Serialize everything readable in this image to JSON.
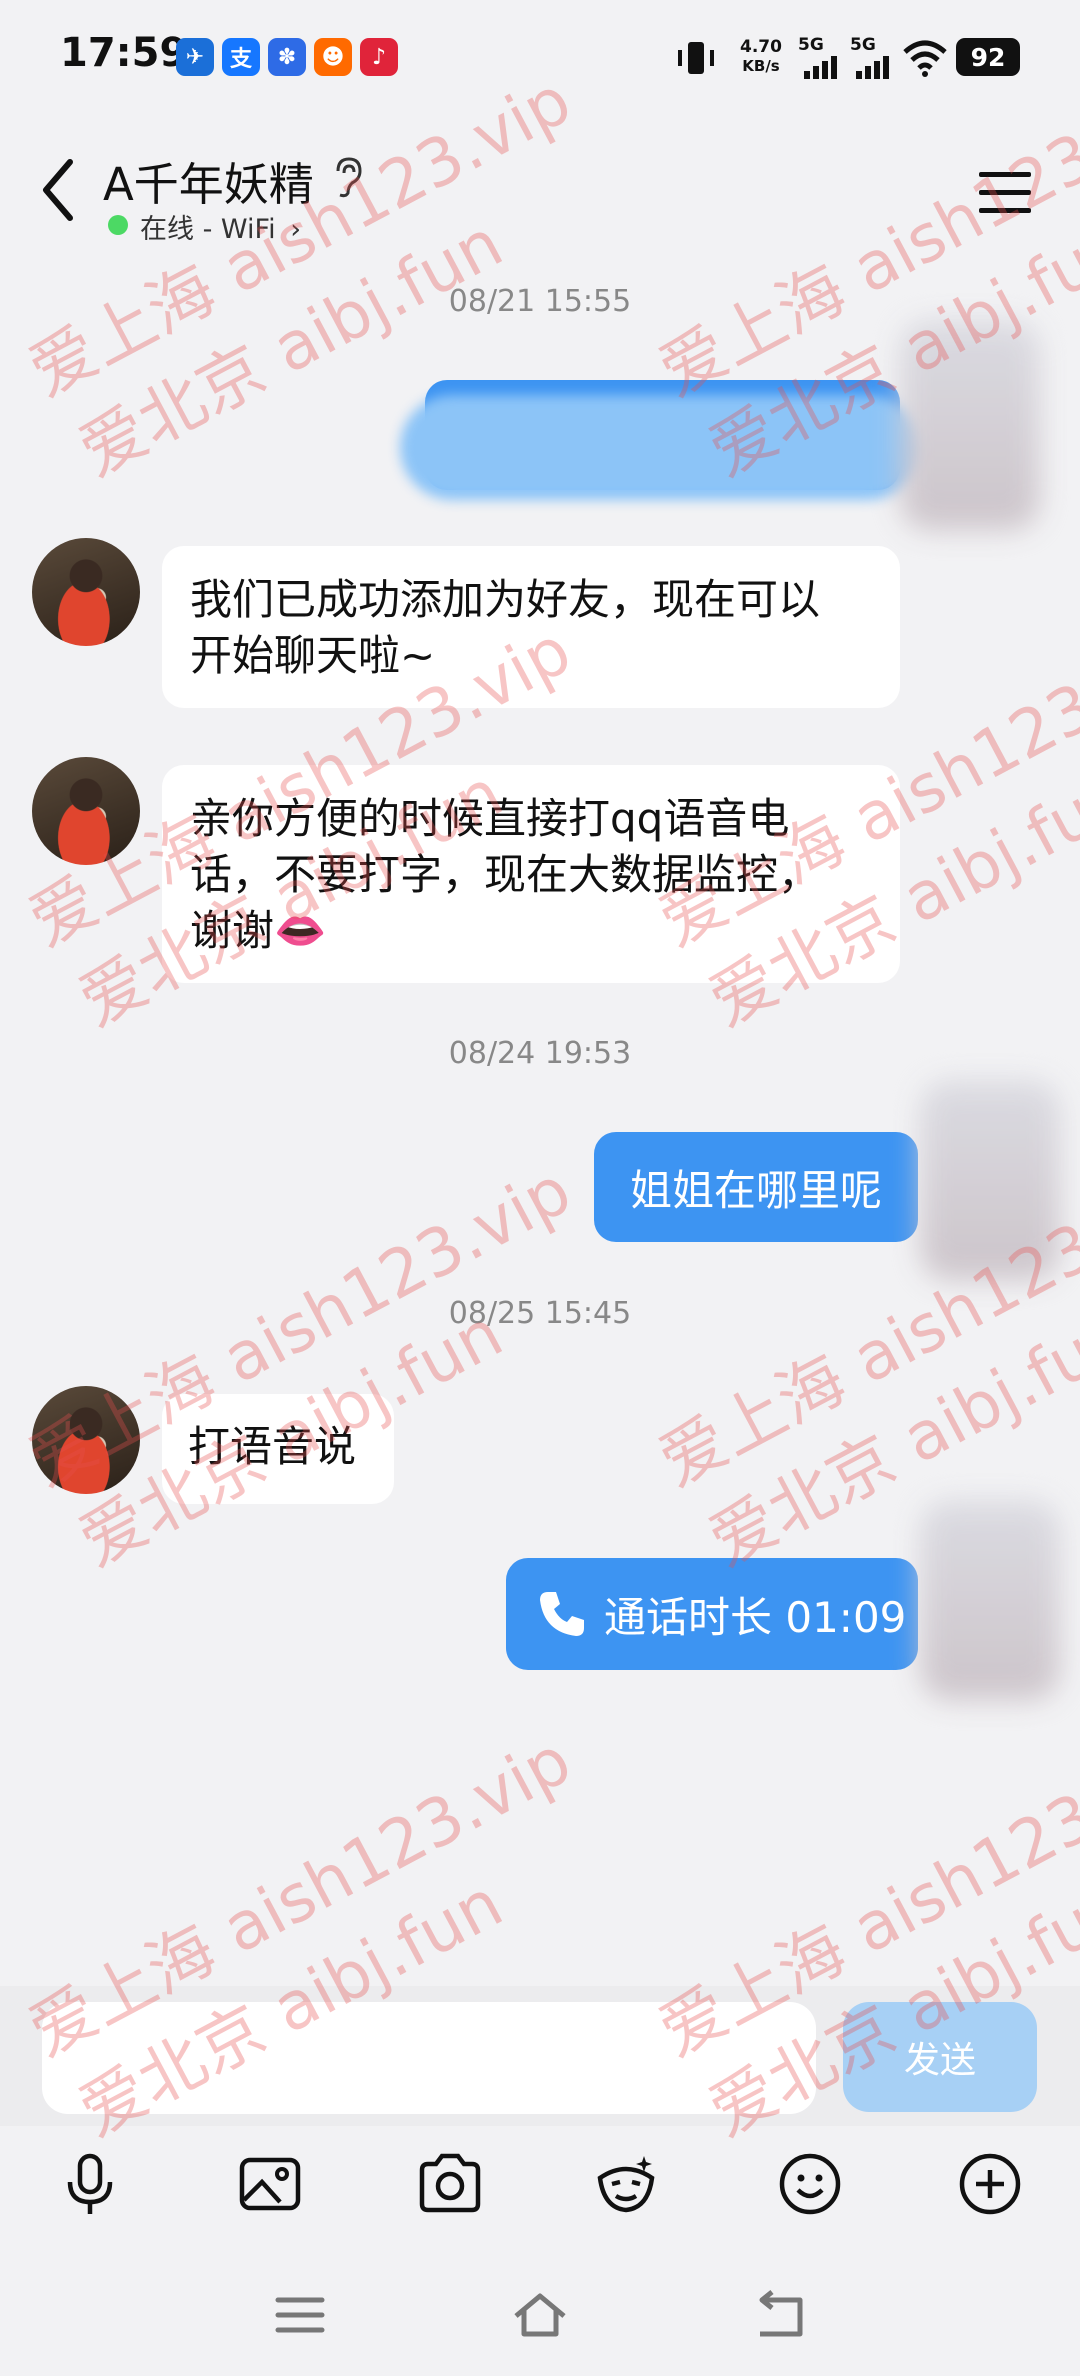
{
  "status_bar": {
    "time": "17:59",
    "net_speed": "4.70",
    "net_speed_unit": "KB/s",
    "sim1": "5G",
    "sim2": "5G",
    "battery": "92",
    "app_icons": [
      "feishu-icon",
      "alipay-icon",
      "baidu-icon",
      "taobao-icon",
      "xiaohongshu-icon"
    ]
  },
  "header": {
    "title": "A千年妖精",
    "status": "在线 - WiFi",
    "status_color": "#4cd964"
  },
  "messages": [
    {
      "type": "timestamp",
      "text": "08/21 15:55"
    },
    {
      "type": "left",
      "lines": [
        "我们已成功添加为好友，现在可以",
        "开始聊天啦~"
      ]
    },
    {
      "type": "left",
      "lines": [
        "亲你方便的时候直接打qq语音电",
        "话，不要打字，现在大数据监控，",
        "谢谢👄"
      ]
    },
    {
      "type": "timestamp",
      "text": "08/24 19:53"
    },
    {
      "type": "right",
      "text": "姐姐在哪里呢"
    },
    {
      "type": "timestamp",
      "text": "08/25 15:45"
    },
    {
      "type": "left",
      "lines": [
        "打语音说"
      ]
    },
    {
      "type": "right-call",
      "text": "通话时长 01:09"
    }
  ],
  "composer": {
    "placeholder": "",
    "send_label": "发送"
  },
  "toolbar": [
    "mic-icon",
    "image-icon",
    "camera-icon",
    "sticker-icon",
    "emoji-icon",
    "plus-icon"
  ],
  "watermark": {
    "line1": "爱上海 aish123.vip",
    "line2": "爱北京 aibj.fun"
  },
  "colors": {
    "accent": "#3d94f2",
    "send_disabled": "#a7d0f5",
    "background": "#f2f2f4"
  }
}
